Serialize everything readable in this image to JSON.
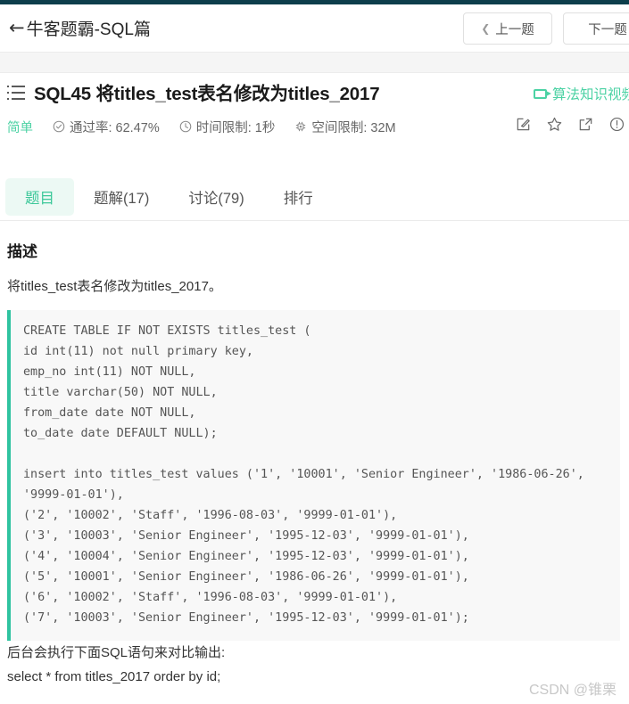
{
  "navbar": {
    "back_icon": "arrow-left-icon",
    "title": "牛客题霸-SQL篇",
    "prev_button": {
      "label": "上一题",
      "icon": "chevron-left-icon"
    },
    "next_button": {
      "label": "下一题"
    }
  },
  "problem": {
    "list_icon": "list-icon",
    "title": "SQL45  将titles_test表名修改为titles_2017",
    "video_link": {
      "label": "算法知识视频讲解",
      "icon": "video-camera-icon",
      "color": "#4cd2a4"
    },
    "difficulty": "简单",
    "meta": [
      {
        "icon": "check-circle-icon",
        "label": "通过率: 62.47%"
      },
      {
        "icon": "clock-icon",
        "label": "时间限制: 1秒"
      },
      {
        "icon": "chip-icon",
        "label": "空间限制: 32M"
      }
    ],
    "actions": [
      "edit-icon",
      "star-icon",
      "share-icon",
      "report-icon"
    ]
  },
  "tabs": [
    {
      "label": "题目",
      "active": true
    },
    {
      "label": "题解(17)",
      "active": false
    },
    {
      "label": "讨论(79)",
      "active": false
    },
    {
      "label": "排行",
      "active": false
    }
  ],
  "description": {
    "heading": "描述",
    "text": "将titles_test表名修改为titles_2017。"
  },
  "code": {
    "create_table": "CREATE TABLE IF NOT EXISTS titles_test (\nid int(11) not null primary key,\nemp_no int(11) NOT NULL,\ntitle varchar(50) NOT NULL,\nfrom_date date NOT NULL,\nto_date date DEFAULT NULL);",
    "insert_stmt": "insert into titles_test values ('1', '10001', 'Senior Engineer', '1986-06-26', '9999-01-01'),\n('2', '10002', 'Staff', '1996-08-03', '9999-01-01'),\n('3', '10003', 'Senior Engineer', '1995-12-03', '9999-01-01'),\n('4', '10004', 'Senior Engineer', '1995-12-03', '9999-01-01'),\n('5', '10001', 'Senior Engineer', '1986-06-26', '9999-01-01'),\n('6', '10002', 'Staff', '1996-08-03', '9999-01-01'),\n('7', '10003', 'Senior Engineer', '1995-12-03', '9999-01-01');"
  },
  "footer": {
    "line1": "后台会执行下面SQL语句来对比输出:",
    "line2": "select * from titles_2017 order by id;"
  },
  "watermark": "CSDN @锥栗",
  "colors": {
    "accent_green": "#3dc89a",
    "light_green_bg": "#ecf9f4",
    "code_bg": "#f8f8f8",
    "code_border": "#2fc3a0",
    "top_strip": "#0d3e4b"
  }
}
